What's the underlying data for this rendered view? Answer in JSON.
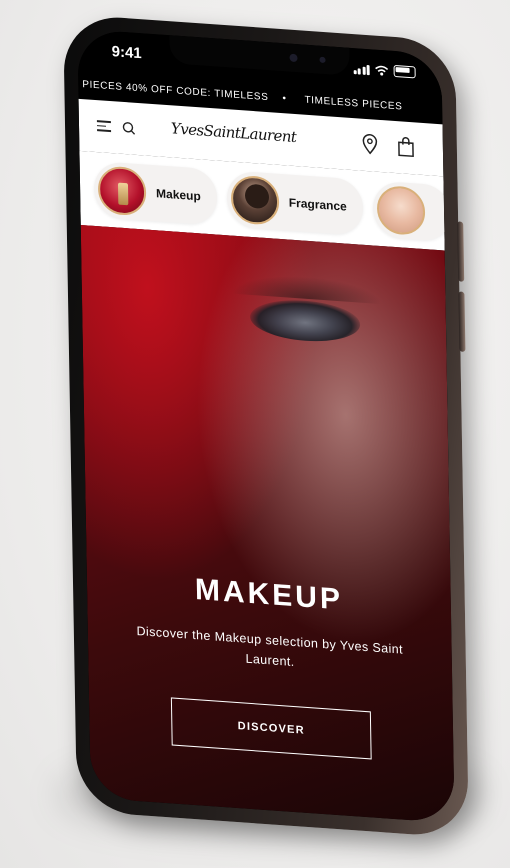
{
  "status_bar": {
    "time": "9:41"
  },
  "promo_bar": {
    "text_primary": "PIECES 40% OFF CODE: TIMELESS",
    "separator": "•",
    "text_secondary": "TIMELESS PIECES"
  },
  "header": {
    "logo_text": "YvesSaintLaurent"
  },
  "categories": [
    {
      "label": "Makeup",
      "thumb": "makeup"
    },
    {
      "label": "Fragrance",
      "thumb": "fragrance"
    },
    {
      "label": "",
      "thumb": "skincare"
    }
  ],
  "hero": {
    "title": "MAKEUP",
    "description": "Discover the Makeup selection by Yves Saint Laurent.",
    "button_label": "DISCOVER"
  },
  "colors": {
    "hero_red": "#8e0a14",
    "promo_bg": "#000000",
    "thumb_border": "#d9b07a"
  },
  "icons": [
    "menu-icon",
    "search-icon",
    "store-locator-icon",
    "shopping-bag-icon",
    "signal-icon",
    "wifi-icon",
    "battery-icon"
  ]
}
